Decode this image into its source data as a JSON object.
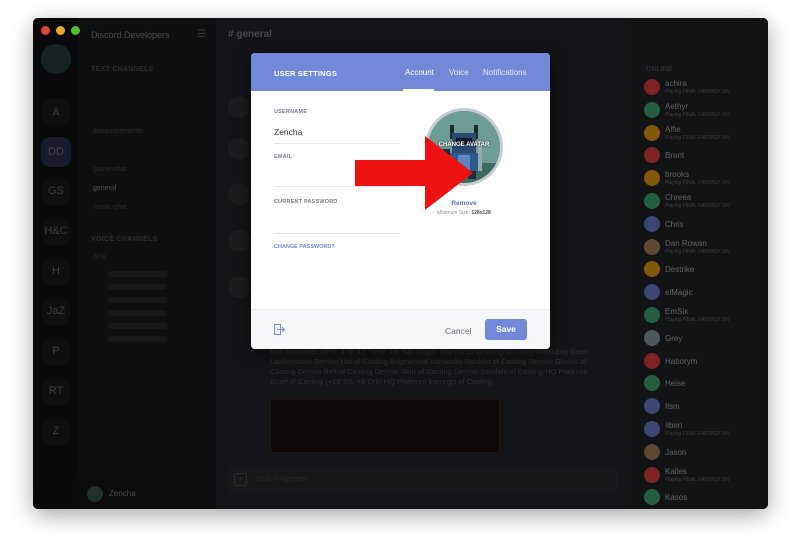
{
  "app": {
    "server_name": "Discord Developers",
    "channel_title": "general"
  },
  "servers": [
    "A",
    "DD",
    "GS",
    "H&C",
    "H",
    "JaZ",
    "P",
    "RT",
    "Z"
  ],
  "channels": {
    "text_category": "TEXT CHANNELS",
    "text_items": [
      "announcements",
      "game-chat",
      "general",
      "music-chat"
    ],
    "voice_category": "VOICE CHANNELS",
    "voice_afk": "AFK"
  },
  "current_user": {
    "name": "Zencha"
  },
  "chat": {
    "message_text": "End encounter DPS: 4.3k ILT Time: 1m 54s Origin: http://sctanbxsumgnd.com/ym4Kn.png Gear: Lawlessborn Demon Hat of Casting Augmented Ironworks Doublet of Casting Demon Gloves of Casting Demon Belt of Casting Demon Skirt of Casting Demon Sandals of Casting HQ Platinum Scarf of Casting (+19 SS, +6 Crit) HQ Platinum Earrings of Casting",
    "input_placeholder": "Chat in #general"
  },
  "members": {
    "header": "ONLINE",
    "list": [
      {
        "name": "achira",
        "playing": "Playing FINAL FANTASY XIV",
        "color": "#f04747"
      },
      {
        "name": "Aethyr",
        "playing": "Playing FINAL FANTASY XIV",
        "color": "#43b581"
      },
      {
        "name": "Alfie",
        "playing": "Playing FINAL FANTASY XIV",
        "color": "#faa61a"
      },
      {
        "name": "Brant",
        "playing": "",
        "color": "#f04747"
      },
      {
        "name": "brooks",
        "playing": "Playing FINAL FANTASY XIV",
        "color": "#faa61a"
      },
      {
        "name": "Chreea",
        "playing": "Playing FINAL FANTASY XIV",
        "color": "#43b581"
      },
      {
        "name": "Chris",
        "playing": "",
        "color": "#7289da"
      },
      {
        "name": "Dan Rowan",
        "playing": "Playing FINAL FANTASY XIV",
        "color": "#b38d5f"
      },
      {
        "name": "Destrike",
        "playing": "",
        "color": "#faa61a"
      },
      {
        "name": "elMagic",
        "playing": "",
        "color": "#7289da"
      },
      {
        "name": "EmSix",
        "playing": "Playing FINAL FANTASY XIV",
        "color": "#43b581"
      },
      {
        "name": "Grey",
        "playing": "",
        "color": "#99aab5"
      },
      {
        "name": "Haborym",
        "playing": "",
        "color": "#f04747"
      },
      {
        "name": "Heise",
        "playing": "",
        "color": "#43b581"
      },
      {
        "name": "Ilsm",
        "playing": "",
        "color": "#7289da"
      },
      {
        "name": "Ilben",
        "playing": "Playing FINAL FANTASY XIV",
        "color": "#7289da"
      },
      {
        "name": "Jason",
        "playing": "",
        "color": "#b38d5f"
      },
      {
        "name": "Kalles",
        "playing": "Playing FINAL FANTASY XIV",
        "color": "#f04747"
      },
      {
        "name": "Kasos",
        "playing": "",
        "color": "#43b581"
      }
    ]
  },
  "modal": {
    "title": "USER SETTINGS",
    "tabs": [
      "Account",
      "Voice",
      "Notifications"
    ],
    "username_label": "USERNAME",
    "username_value": "Zencha",
    "email_label": "EMAIL",
    "current_password_label": "CURRENT PASSWORD",
    "change_password_link": "CHANGE PASSWORD?",
    "change_avatar_text": "CHANGE AVATAR",
    "remove_link": "Remove",
    "min_size_label": "Minimum Size: ",
    "min_size_value": "128x128",
    "cancel_label": "Cancel",
    "save_label": "Save"
  },
  "colors": {
    "accent": "#7289da",
    "arrow": "#ee1111",
    "background_dark": "#2f3136"
  },
  "icons": [
    "close-dot",
    "minimize-dot",
    "maximize-dot",
    "hamburger-menu-icon",
    "plus-icon",
    "logout-icon",
    "red-arrow-icon"
  ]
}
